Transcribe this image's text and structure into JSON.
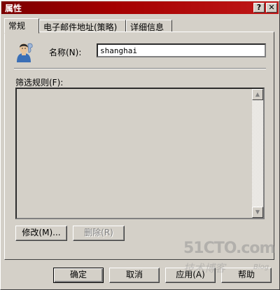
{
  "window": {
    "title": "属性",
    "help_button": "?",
    "close_button": "✕"
  },
  "tabs": [
    {
      "label": "常规",
      "active": true
    },
    {
      "label": "电子邮件地址(策略)",
      "active": false
    },
    {
      "label": "详细信息",
      "active": false
    }
  ],
  "general": {
    "name_label": "名称(N):",
    "name_value": "shanghai",
    "filter_label": "筛选规则(F):",
    "avatar_icon": "user-icon",
    "modify_button": "修改(M)...",
    "delete_button": "删除(R)",
    "delete_enabled": false
  },
  "footer": {
    "ok": "确定",
    "cancel": "取消",
    "apply": "应用(A)",
    "help": "帮助"
  },
  "watermark": {
    "domain": "51CTO.com",
    "sub": "技术博客",
    "blog": "Blog"
  }
}
